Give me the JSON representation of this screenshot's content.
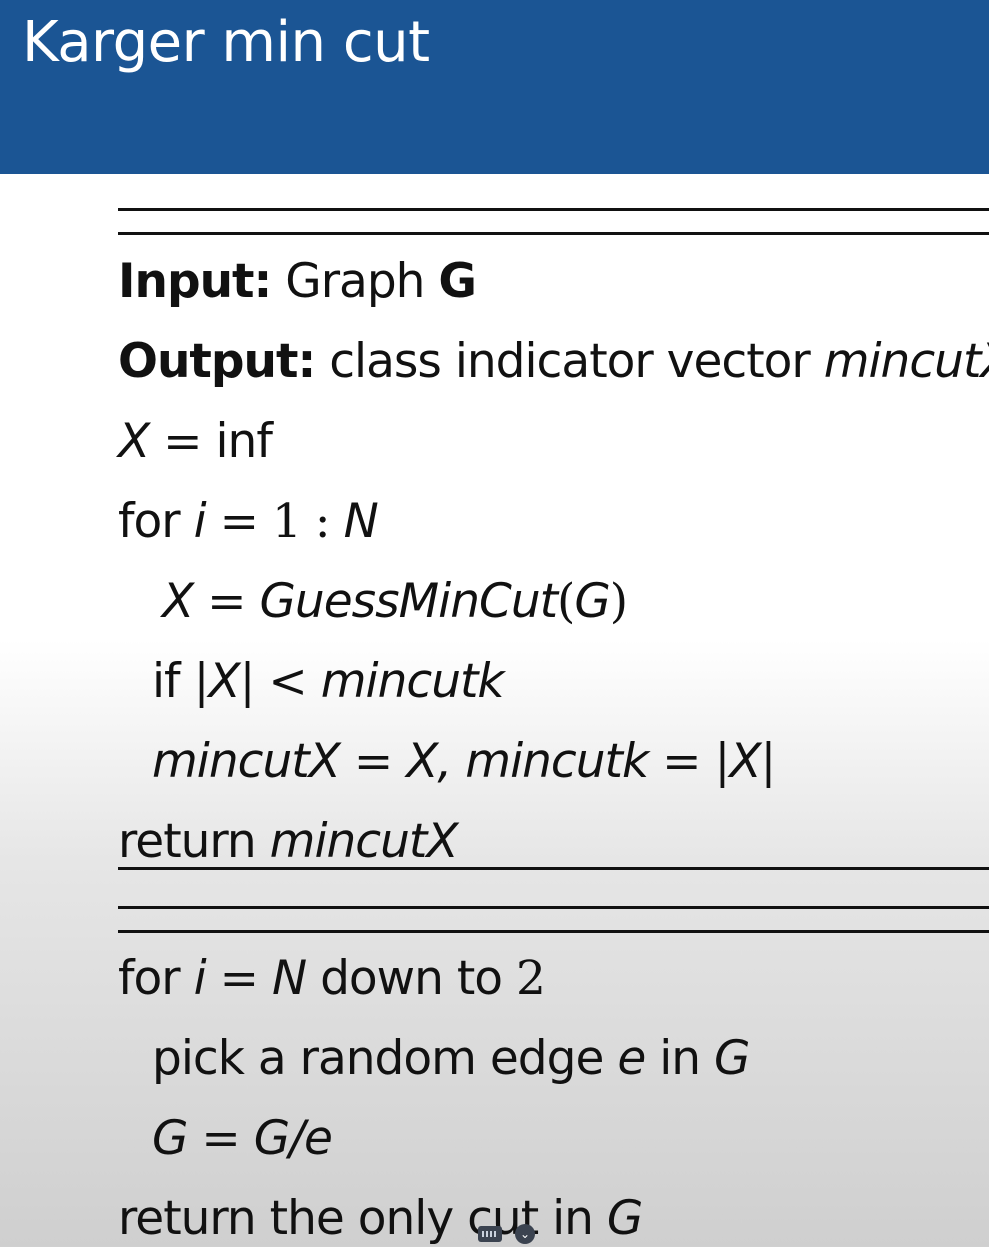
{
  "title": "Karger min cut",
  "algo1": {
    "input_label": "Input:",
    "input_text": "Graph",
    "input_var": "G",
    "output_label": "Output:",
    "output_text": "class indicator vector",
    "output_var": "mincutX",
    "line_x_var": "X",
    "line_x_eq": "=",
    "line_x_val": "inf",
    "for_kw": "for",
    "for_var": "i",
    "for_eq": "=",
    "for_range": "1 :",
    "for_n": "N",
    "guess_var": "X",
    "guess_eq": "=",
    "guess_fn": "GuessMinCut",
    "guess_paren_open": "(",
    "guess_arg": "G",
    "guess_paren_close": ")",
    "if_kw": "if",
    "if_abs_open": "|",
    "if_var": "X",
    "if_abs_close": "|",
    "if_lt": "<",
    "if_rhs": "mincutk",
    "assign_lhs1": "mincutX",
    "assign_eq1": "=",
    "assign_rhs1": "X,",
    "assign_lhs2": "mincutk",
    "assign_eq2": "=",
    "assign_abs_open": "|",
    "assign_rhs2": "X",
    "assign_abs_close": "|",
    "return_kw": "return",
    "return_var": "mincutX"
  },
  "algo2": {
    "for_kw": "for",
    "for_var": "i",
    "for_eq": "=",
    "for_n": "N",
    "for_text": "down to",
    "for_end": "2",
    "pick_text": "pick a random edge",
    "pick_var": "e",
    "pick_in": "in",
    "pick_graph": "G",
    "contract_lhs": "G",
    "contract_eq": "=",
    "contract_rhs": "G/e",
    "return_text": "return the only cut in",
    "return_var": "G"
  },
  "overlay": {
    "keyboard_icon": "keyboard-icon",
    "chevron_icon": "chevron-down-icon"
  }
}
